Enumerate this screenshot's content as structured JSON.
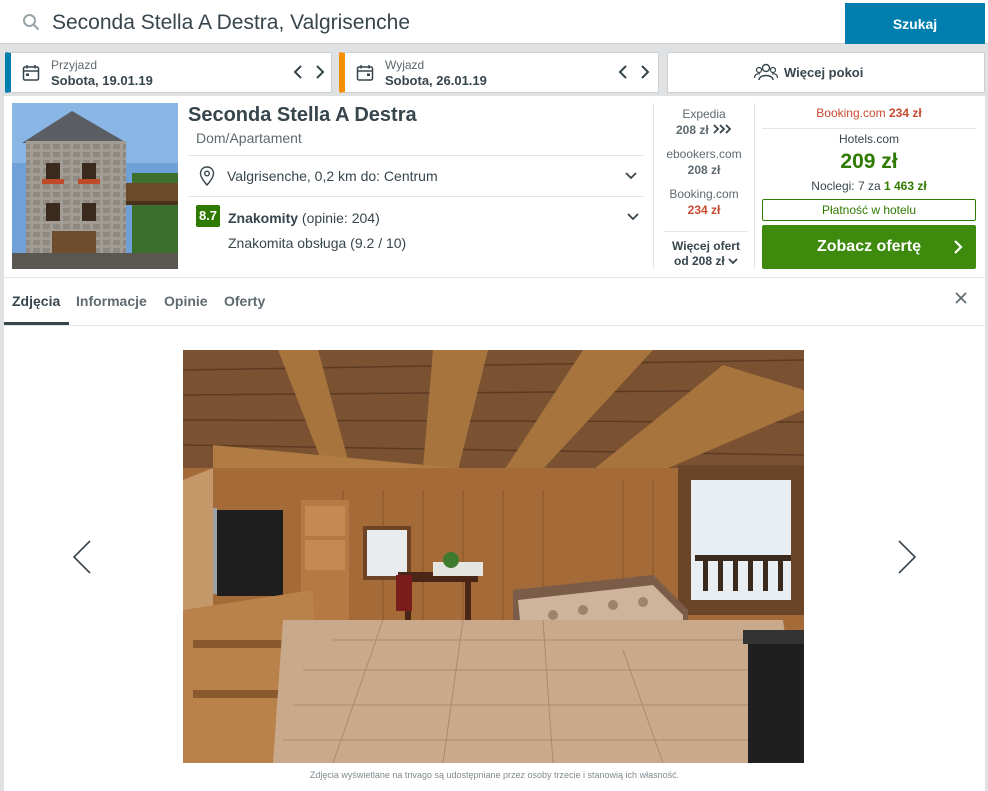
{
  "search": {
    "query": "Seconda Stella A Destra, Valgrisenche",
    "button_label": "Szukaj"
  },
  "dates": {
    "checkin": {
      "label": "Przyjazd",
      "value": "Sobota, 19.01.19"
    },
    "checkout": {
      "label": "Wyjazd",
      "value": "Sobota, 26.01.19"
    },
    "rooms_label": "Więcej pokoi"
  },
  "hotel": {
    "name": "Seconda Stella A Destra",
    "type": "Dom/Apartament",
    "location": "Valgrisenche, 0,2 km do: Centrum",
    "rating": {
      "score": "8.7",
      "label": "Znakomity",
      "reviews": "(opinie: 204)",
      "sub": "Znakomita obsługa (9.2 / 10)"
    }
  },
  "offers": [
    {
      "site": "Expedia",
      "price": "208 zł"
    },
    {
      "site": "ebookers.com",
      "price": "208 zł"
    },
    {
      "site": "Booking.com",
      "price": "234 zł"
    }
  ],
  "more_offers": {
    "line1": "Więcej ofert",
    "line2": "od 208 zł"
  },
  "deal": {
    "top_site": "Booking.com",
    "top_price": "234 zł",
    "site": "Hotels.com",
    "price": "209 zł",
    "nights_prefix": "Noclegi: 7 za",
    "nights_total": "1 463 zł",
    "pay_at_hotel": "Płatność w hotelu",
    "cta": "Zobacz ofertę"
  },
  "tabs": [
    "Zdjęcia",
    "Informacje",
    "Opinie",
    "Oferty"
  ],
  "photo_credit": "Zdjęcia wyświetlane na trivago są udostępniane przez osoby trzecie i stanowią ich własność.",
  "colors": {
    "brand_blue": "#007faf",
    "checkout_orange": "#f48f00",
    "deal_green": "#3e8a0c",
    "price_red": "#c94a30"
  }
}
